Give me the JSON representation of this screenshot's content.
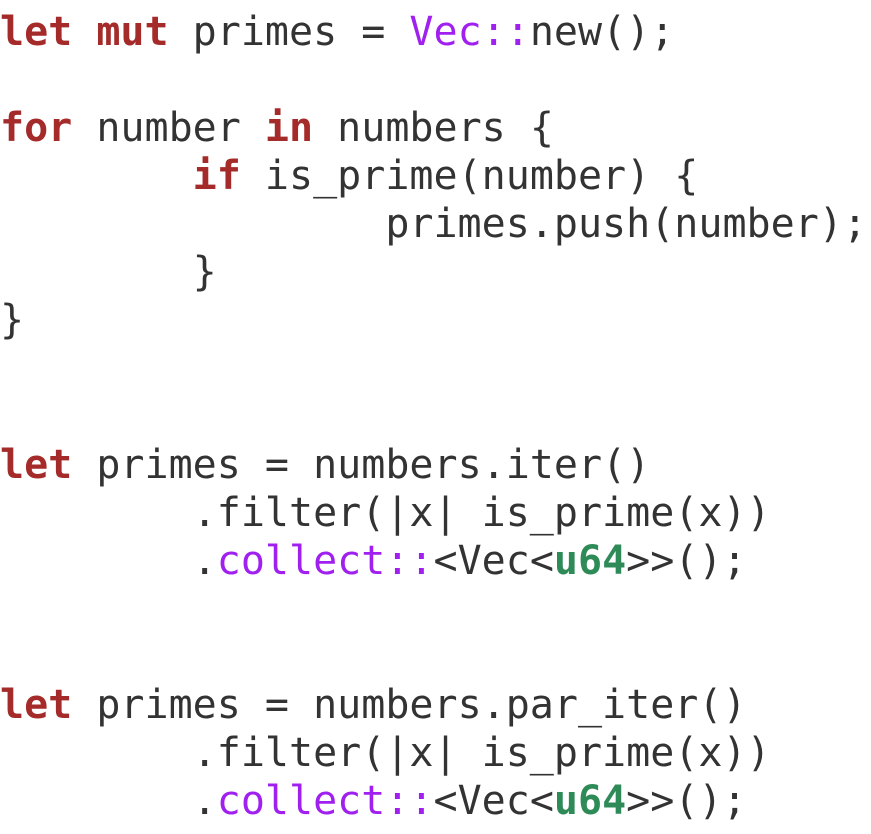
{
  "code": {
    "block1": {
      "line1": {
        "kw_let": "let",
        "kw_mut": "mut",
        "t1": " primes = ",
        "path": "Vec::",
        "t2": "new();"
      },
      "line3": {
        "kw_for": "for",
        "t1": " number ",
        "kw_in": "in",
        "t2": " numbers {"
      },
      "line4": {
        "indent": "        ",
        "kw_if": "if",
        "t1": " is_prime(number) {"
      },
      "line5": {
        "text": "                primes.push(number);"
      },
      "line6": {
        "text": "        }"
      },
      "line7": {
        "text": "}"
      }
    },
    "block2": {
      "line1": {
        "kw_let": "let",
        "t1": " primes = numbers.iter()"
      },
      "line2": {
        "text": "        .filter(|x| is_prime(x))"
      },
      "line3": {
        "t0": "        .",
        "path": "collect::",
        "t1": "<Vec<",
        "ty": "u64",
        "t2": ">>();"
      }
    },
    "block3": {
      "line1": {
        "kw_let": "let",
        "t1": " primes = numbers.par_iter()"
      },
      "line2": {
        "text": "        .filter(|x| is_prime(x))"
      },
      "line3": {
        "t0": "        .",
        "path": "collect::",
        "t1": "<Vec<",
        "ty": "u64",
        "t2": ">>();"
      }
    }
  },
  "colors": {
    "keyword": "#a52a2a",
    "path": "#a020f0",
    "type": "#2e8b57",
    "text": "#333333",
    "background": "#ffffff"
  }
}
